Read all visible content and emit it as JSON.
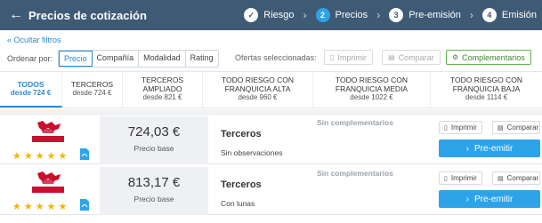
{
  "header": {
    "back_icon": "arrow-left-icon",
    "title": "Precios de cotización",
    "steps": [
      {
        "num": "✓",
        "label": "Riesgo",
        "state": "done"
      },
      {
        "num": "2",
        "label": "Precios",
        "state": "active"
      },
      {
        "num": "3",
        "label": "Pre-emisión",
        "state": "todo"
      },
      {
        "num": "4",
        "label": "Emisión",
        "state": "todo"
      }
    ]
  },
  "filters": {
    "hide_label": "« Ocultar filtros",
    "order_label": "Ordenar por:",
    "order_options": [
      "Precio",
      "Compañía",
      "Modalidad",
      "Rating"
    ],
    "order_selected": "Precio",
    "offers_label": "Ofertas seleccionadas:",
    "print_label": "Imprimir",
    "compare_label": "Comparar",
    "complementarios_label": "Complementarios"
  },
  "categories": [
    {
      "title": "TODOS",
      "price": "desde 724 €",
      "active": true
    },
    {
      "title": "TERCEROS",
      "price": "desde 724 €",
      "active": false
    },
    {
      "title": "TERCEROS AMPLIADO",
      "price": "desde 821 €",
      "active": false
    },
    {
      "title": "TODO RIESGO CON FRANQUICIA ALTA",
      "price": "desde 960 €",
      "active": false
    },
    {
      "title": "TODO RIESGO CON FRANQUICIA MEDIA",
      "price": "desde 1022 €",
      "active": false
    },
    {
      "title": "TODO RIESGO CON FRANQUICIA BAJA",
      "price": "desde 1114 €",
      "active": false
    }
  ],
  "results": [
    {
      "insurer": "GENERALI",
      "rating": 5,
      "price": "724,03 €",
      "price_sub": "Precio base",
      "coverage": "Terceros",
      "notes": "Sin observaciones",
      "complementarios": "Sin complementarios",
      "print_label": "Imprimir",
      "compare_label": "Comparar",
      "preemit_label": "Pre-emitir"
    },
    {
      "insurer": "GENERALI",
      "rating": 5,
      "price": "813,17 €",
      "price_sub": "Precio base",
      "coverage": "Terceros",
      "notes": "Con lunas",
      "complementarios": "Sin complementarios",
      "print_label": "Imprimir",
      "compare_label": "Comparar",
      "preemit_label": "Pre-emitir"
    }
  ],
  "colors": {
    "header_bg": "#3f5a75",
    "accent": "#2da3ea",
    "link": "#2a8ad4",
    "star": "#f3b400",
    "generali_red": "#c8102e"
  }
}
